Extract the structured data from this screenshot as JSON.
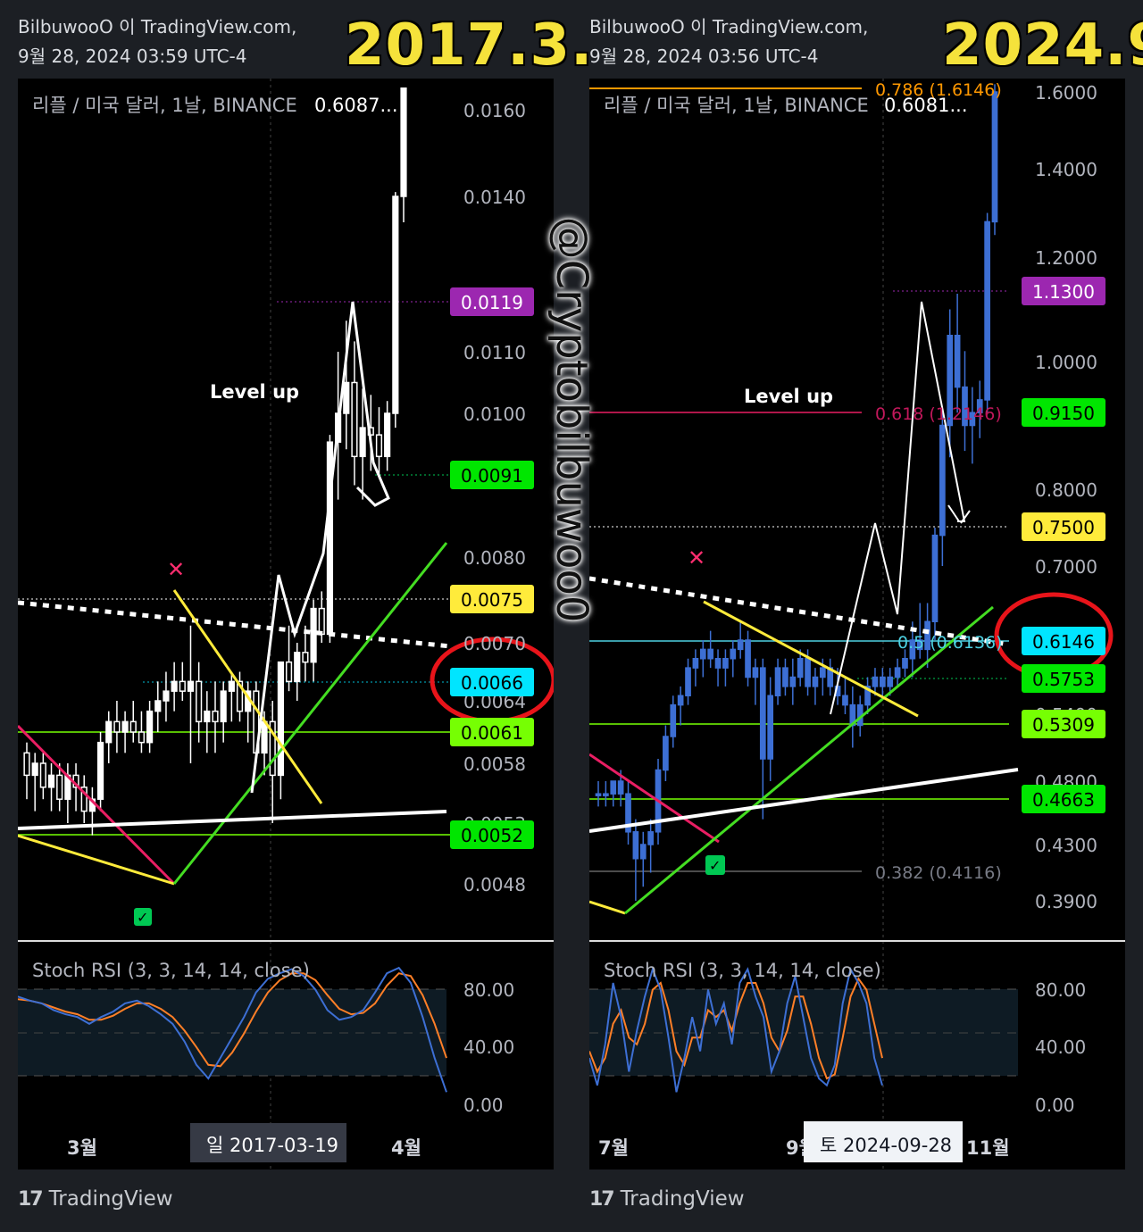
{
  "left": {
    "header_line1": "BilbuwooO 이 TradingView.com,",
    "header_line2": "9월 28, 2024 03:59 UTC-4",
    "big_date": "2017.3.",
    "symbol_line": "리플 / 미국 달러, 1날, BINANCE",
    "symbol_price": "0.6087...",
    "annotation": "Level up",
    "osc_title": "Stoch RSI (3, 3, 14, 14, close)",
    "crosshair_date": "일 2017-03-19",
    "x_labels": [
      "3월",
      "4월"
    ],
    "price_ticks": [
      "0.0160",
      "0.0140",
      "0.0110",
      "0.0100",
      "0.0080",
      "0.0070",
      "0.0064",
      "0.0058",
      "0.0053",
      "0.0048"
    ],
    "price_tags": [
      {
        "label": "0.0119",
        "color": "#9c27b0",
        "text_color": "#ffffff"
      },
      {
        "label": "0.0091",
        "color": "#00e600",
        "text_color": "#000000"
      },
      {
        "label": "0.0075",
        "color": "#ffeb3b",
        "text_color": "#000000"
      },
      {
        "label": "0.0066",
        "color": "#00e5ff",
        "text_color": "#000000"
      },
      {
        "label": "0.0061",
        "color": "#76ff03",
        "text_color": "#000000"
      },
      {
        "label": "0.0052",
        "color": "#00e600",
        "text_color": "#000000"
      }
    ],
    "osc_ticks": [
      "80.00",
      "40.00",
      "0.00"
    ]
  },
  "right": {
    "header_line1": "BilbuwooO 이 TradingView.com,",
    "header_line2": "9월 28, 2024 03:56 UTC-4",
    "big_date": "2024.9.",
    "symbol_line": "리플 / 미국 달러, 1날, BINANCE",
    "symbol_price": "0.6081...",
    "annotation": "Level up",
    "osc_title": "Stoch RSI (3, 3, 14, 14, close)",
    "crosshair_date": "토 2024-09-28",
    "x_labels": [
      "7월",
      "9월",
      "11월"
    ],
    "price_ticks": [
      "1.6000",
      "1.4000",
      "1.2000",
      "1.0000",
      "0.8000",
      "0.7000",
      "0.5400",
      "0.4800",
      "0.4300",
      "0.3900"
    ],
    "fib_labels": [
      "0.786 (1.6146)",
      "0.618 (1.2146)",
      "0.5 (0.6136)",
      "0.382 (0.4116)"
    ],
    "price_tags": [
      {
        "label": "1.1300",
        "color": "#9c27b0",
        "text_color": "#ffffff"
      },
      {
        "label": "0.9150",
        "color": "#00e600",
        "text_color": "#000000"
      },
      {
        "label": "0.7500",
        "color": "#ffeb3b",
        "text_color": "#000000"
      },
      {
        "label": "0.6146",
        "color": "#00e5ff",
        "text_color": "#000000"
      },
      {
        "label": "0.5753",
        "color": "#00e600",
        "text_color": "#000000"
      },
      {
        "label": "0.5309",
        "color": "#76ff03",
        "text_color": "#000000"
      },
      {
        "label": "0.4663",
        "color": "#00e600",
        "text_color": "#000000"
      }
    ],
    "osc_ticks": [
      "80.00",
      "40.00",
      "0.00"
    ]
  },
  "watermark": "@Cryptobilbuwoo0",
  "footer_brand": "TradingView",
  "chart_data": [
    {
      "type": "candlestick",
      "title": "리플 / 미국 달러, 1날, BINANCE",
      "period": "2017.3.",
      "ylim": [
        0.0045,
        0.0165
      ],
      "candles": [
        [
          0.0059,
          0.006,
          0.0055,
          0.0057
        ],
        [
          0.0057,
          0.0059,
          0.0054,
          0.0058
        ],
        [
          0.0058,
          0.0059,
          0.0055,
          0.0056
        ],
        [
          0.0056,
          0.0058,
          0.0054,
          0.0057
        ],
        [
          0.0057,
          0.0058,
          0.0054,
          0.0055
        ],
        [
          0.0055,
          0.0058,
          0.0053,
          0.0057
        ],
        [
          0.0057,
          0.0058,
          0.0054,
          0.0056
        ],
        [
          0.0056,
          0.0057,
          0.0053,
          0.0054
        ],
        [
          0.0054,
          0.0056,
          0.0052,
          0.0055
        ],
        [
          0.0055,
          0.0061,
          0.0054,
          0.006
        ],
        [
          0.006,
          0.0063,
          0.0058,
          0.0062
        ],
        [
          0.0062,
          0.0064,
          0.0059,
          0.0061
        ],
        [
          0.0061,
          0.0063,
          0.0059,
          0.0062
        ],
        [
          0.0062,
          0.0064,
          0.006,
          0.0061
        ],
        [
          0.0061,
          0.0063,
          0.0059,
          0.006
        ],
        [
          0.006,
          0.0064,
          0.0059,
          0.0063
        ],
        [
          0.0063,
          0.0066,
          0.0061,
          0.0064
        ],
        [
          0.0064,
          0.0067,
          0.0062,
          0.0065
        ],
        [
          0.0065,
          0.0068,
          0.0063,
          0.0066
        ],
        [
          0.0066,
          0.0068,
          0.0064,
          0.0065
        ],
        [
          0.0065,
          0.0072,
          0.0058,
          0.0066
        ],
        [
          0.0066,
          0.0068,
          0.006,
          0.0062
        ],
        [
          0.0062,
          0.0065,
          0.0059,
          0.0063
        ],
        [
          0.0063,
          0.0066,
          0.0059,
          0.0062
        ],
        [
          0.0062,
          0.0066,
          0.006,
          0.0065
        ],
        [
          0.0065,
          0.0067,
          0.0062,
          0.0066
        ],
        [
          0.0066,
          0.0067,
          0.0062,
          0.0063
        ],
        [
          0.0063,
          0.0066,
          0.006,
          0.0065
        ],
        [
          0.0065,
          0.0066,
          0.0058,
          0.0059
        ],
        [
          0.0059,
          0.0063,
          0.0057,
          0.0062
        ],
        [
          0.0062,
          0.0064,
          0.0053,
          0.0057
        ],
        [
          0.0057,
          0.0068,
          0.0055,
          0.0068
        ],
        [
          0.0068,
          0.0072,
          0.0065,
          0.0066
        ],
        [
          0.0066,
          0.007,
          0.0064,
          0.0069
        ],
        [
          0.0069,
          0.0072,
          0.0066,
          0.0068
        ],
        [
          0.0068,
          0.0075,
          0.0066,
          0.0074
        ],
        [
          0.0074,
          0.0076,
          0.007,
          0.0071
        ],
        [
          0.0071,
          0.0097,
          0.007,
          0.0096
        ],
        [
          0.0096,
          0.011,
          0.0088,
          0.01
        ],
        [
          0.01,
          0.0116,
          0.0095,
          0.0105
        ],
        [
          0.0105,
          0.0112,
          0.009,
          0.0094
        ],
        [
          0.0094,
          0.0104,
          0.0088,
          0.0098
        ],
        [
          0.0098,
          0.0103,
          0.0092,
          0.0097
        ],
        [
          0.0097,
          0.0101,
          0.0091,
          0.0094
        ],
        [
          0.0094,
          0.0102,
          0.0092,
          0.01
        ],
        [
          0.01,
          0.0141,
          0.0098,
          0.014
        ],
        [
          0.014,
          0.0165,
          0.0135,
          0.0165
        ]
      ],
      "stoch_rsi": {
        "k": [
          75,
          72,
          70,
          65,
          62,
          60,
          55,
          60,
          64,
          70,
          72,
          68,
          62,
          55,
          42,
          25,
          15,
          30,
          45,
          60,
          78,
          88,
          92,
          95,
          90,
          80,
          65,
          58,
          60,
          65,
          78,
          92,
          96,
          85,
          60,
          30,
          5
        ],
        "d": [
          73,
          72,
          70,
          67,
          64,
          62,
          58,
          58,
          61,
          66,
          70,
          70,
          66,
          60,
          50,
          38,
          25,
          24,
          34,
          48,
          64,
          78,
          87,
          92,
          92,
          87,
          76,
          66,
          62,
          63,
          70,
          83,
          92,
          90,
          76,
          55,
          30
        ]
      }
    },
    {
      "type": "candlestick",
      "title": "리플 / 미국 달러, 1날, BINANCE",
      "period": "2024.9.",
      "ylim": [
        0.37,
        1.66
      ],
      "candles": [
        [
          0.47,
          0.48,
          0.46,
          0.47
        ],
        [
          0.47,
          0.48,
          0.46,
          0.47
        ],
        [
          0.47,
          0.48,
          0.46,
          0.48
        ],
        [
          0.48,
          0.49,
          0.46,
          0.47
        ],
        [
          0.47,
          0.48,
          0.43,
          0.44
        ],
        [
          0.44,
          0.45,
          0.39,
          0.42
        ],
        [
          0.42,
          0.44,
          0.4,
          0.43
        ],
        [
          0.43,
          0.45,
          0.41,
          0.44
        ],
        [
          0.44,
          0.5,
          0.43,
          0.49
        ],
        [
          0.49,
          0.53,
          0.48,
          0.52
        ],
        [
          0.52,
          0.56,
          0.51,
          0.55
        ],
        [
          0.55,
          0.57,
          0.53,
          0.56
        ],
        [
          0.56,
          0.6,
          0.55,
          0.59
        ],
        [
          0.59,
          0.61,
          0.57,
          0.6
        ],
        [
          0.6,
          0.62,
          0.58,
          0.61
        ],
        [
          0.61,
          0.63,
          0.59,
          0.6
        ],
        [
          0.6,
          0.61,
          0.57,
          0.59
        ],
        [
          0.59,
          0.61,
          0.57,
          0.6
        ],
        [
          0.6,
          0.62,
          0.58,
          0.61
        ],
        [
          0.61,
          0.64,
          0.6,
          0.62
        ],
        [
          0.62,
          0.63,
          0.57,
          0.58
        ],
        [
          0.58,
          0.6,
          0.55,
          0.59
        ],
        [
          0.59,
          0.6,
          0.45,
          0.5
        ],
        [
          0.5,
          0.58,
          0.48,
          0.56
        ],
        [
          0.56,
          0.6,
          0.55,
          0.59
        ],
        [
          0.59,
          0.6,
          0.56,
          0.57
        ],
        [
          0.57,
          0.6,
          0.55,
          0.58
        ],
        [
          0.58,
          0.61,
          0.57,
          0.6
        ],
        [
          0.6,
          0.61,
          0.56,
          0.57
        ],
        [
          0.57,
          0.59,
          0.55,
          0.58
        ],
        [
          0.58,
          0.6,
          0.56,
          0.59
        ],
        [
          0.59,
          0.6,
          0.56,
          0.57
        ],
        [
          0.57,
          0.59,
          0.55,
          0.56
        ],
        [
          0.56,
          0.58,
          0.54,
          0.55
        ],
        [
          0.55,
          0.57,
          0.51,
          0.53
        ],
        [
          0.53,
          0.56,
          0.52,
          0.55
        ],
        [
          0.55,
          0.58,
          0.54,
          0.57
        ],
        [
          0.57,
          0.59,
          0.56,
          0.58
        ],
        [
          0.58,
          0.59,
          0.56,
          0.57
        ],
        [
          0.57,
          0.59,
          0.56,
          0.58
        ],
        [
          0.58,
          0.6,
          0.57,
          0.59
        ],
        [
          0.59,
          0.61,
          0.58,
          0.6
        ],
        [
          0.6,
          0.64,
          0.58,
          0.62
        ],
        [
          0.62,
          0.66,
          0.6,
          0.61
        ],
        [
          0.61,
          0.66,
          0.59,
          0.64
        ],
        [
          0.64,
          0.75,
          0.62,
          0.74
        ],
        [
          0.74,
          0.92,
          0.7,
          0.9
        ],
        [
          0.9,
          1.1,
          0.85,
          1.05
        ],
        [
          1.05,
          1.13,
          0.92,
          0.96
        ],
        [
          0.96,
          1.02,
          0.86,
          0.9
        ],
        [
          0.9,
          0.96,
          0.84,
          0.92
        ],
        [
          0.92,
          0.97,
          0.88,
          0.94
        ],
        [
          0.94,
          1.3,
          0.92,
          1.28
        ],
        [
          1.28,
          1.62,
          1.25,
          1.6
        ]
      ],
      "stoch_rsi": {
        "k": [
          30,
          10,
          40,
          85,
          60,
          20,
          50,
          75,
          95,
          80,
          45,
          5,
          30,
          60,
          35,
          80,
          55,
          70,
          40,
          85,
          95,
          75,
          60,
          20,
          35,
          70,
          90,
          60,
          30,
          15,
          10,
          25,
          70,
          95,
          85,
          70,
          30,
          10
        ],
        "d": [
          35,
          20,
          30,
          55,
          65,
          45,
          40,
          55,
          80,
          85,
          65,
          35,
          25,
          45,
          45,
          65,
          60,
          65,
          50,
          70,
          85,
          85,
          70,
          45,
          35,
          50,
          75,
          75,
          55,
          30,
          15,
          18,
          45,
          75,
          88,
          80,
          55,
          30
        ]
      }
    }
  ]
}
